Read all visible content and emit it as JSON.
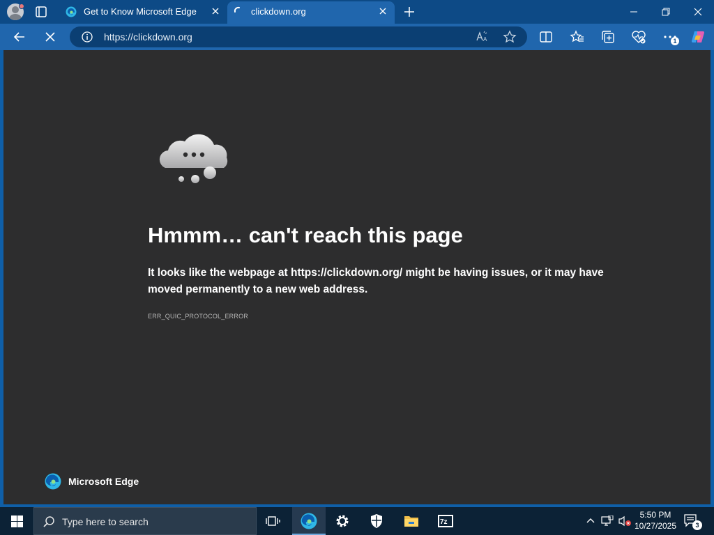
{
  "browser": {
    "tabs": [
      {
        "title": "Get to Know Microsoft Edge",
        "active": false,
        "icon": "edge-icon"
      },
      {
        "title": "clickdown.org",
        "active": true,
        "icon": "loading-spinner-icon"
      }
    ],
    "address": {
      "url": "https://clickdown.org"
    }
  },
  "error_page": {
    "title": "Hmmm… can't reach this page",
    "description": "It looks like the webpage at https://clickdown.org/ might be having issues, or it may have moved permanently to a new web address.",
    "error_code": "ERR_QUIC_PROTOCOL_ERROR",
    "brand_name": "Microsoft Edge"
  },
  "toolbar": {
    "extensions_badge": "1"
  },
  "taskbar": {
    "search_placeholder": "Type here to search",
    "time": "5:50 PM",
    "date": "10/27/2025",
    "notification_count": "3"
  },
  "colors": {
    "titlebar": "#0d4a86",
    "toolbar": "#2066ad",
    "page_bg": "#2d2d2e",
    "taskbar": "#0c2236"
  }
}
